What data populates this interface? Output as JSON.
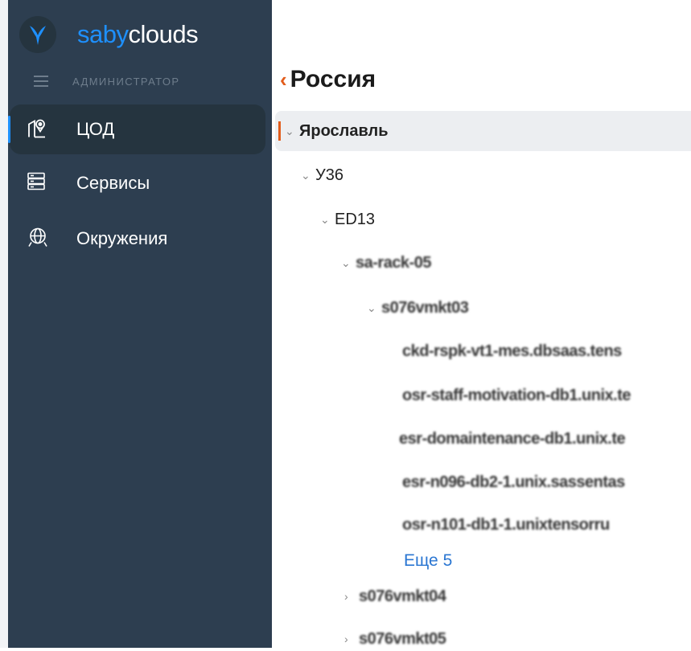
{
  "sidebar": {
    "logo": {
      "saby": "saby",
      "clouds": "clouds"
    },
    "role": "АДМИНИСТРАТОР",
    "items": [
      {
        "label": "ЦОД",
        "icon": "datacenter-location-icon",
        "active": true
      },
      {
        "label": "Сервисы",
        "icon": "services-list-icon",
        "active": false
      },
      {
        "label": "Окружения",
        "icon": "environment-globe-icon",
        "active": false
      }
    ],
    "colors": {
      "background": "#2d3e50",
      "accent": "#1e90ff"
    }
  },
  "main": {
    "title": "Россия",
    "accent_color": "#e25c1b",
    "tree": {
      "city": "Ярославль",
      "building": "У36",
      "room": "ED13",
      "rack": "sa-rack-05",
      "host": "s076vmkt03",
      "children": [
        "ckd-rspk-vt1-mes.dbsaas.tens",
        "osr-staff-motivation-db1.unix.te",
        "esr-domaintenance-db1.unix.te",
        "esr-n096-db2-1.unix.sassentas",
        "osr-n101-db1-1.unixtensorru"
      ],
      "more_link": "Еще 5",
      "siblings": [
        "s076vmkt04",
        "s076vmkt05"
      ]
    }
  }
}
